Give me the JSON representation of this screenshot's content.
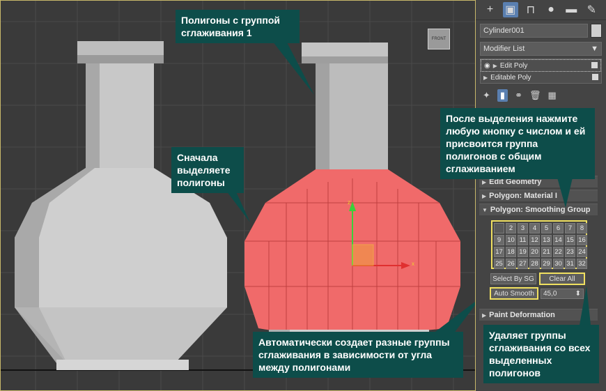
{
  "panel": {
    "object_name": "Cylinder001",
    "modifier_list": "Modifier List",
    "stack": [
      {
        "label": "Edit Poly"
      },
      {
        "label": "Editable Poly"
      }
    ],
    "rollouts": {
      "edit_geometry": "Edit Geometry",
      "material": "Polygon: Material I",
      "smoothing": "Polygon: Smoothing Group",
      "paint": "Paint Deformation"
    },
    "smoothing_groups": [
      "1",
      "2",
      "3",
      "4",
      "5",
      "6",
      "7",
      "8",
      "9",
      "10",
      "11",
      "12",
      "13",
      "14",
      "15",
      "16",
      "17",
      "18",
      "19",
      "20",
      "21",
      "22",
      "23",
      "24",
      "25",
      "26",
      "27",
      "28",
      "29",
      "30",
      "31",
      "32"
    ],
    "select_by_sg": "Select By SG",
    "clear_all": "Clear All",
    "auto_smooth": "Auto Smooth",
    "threshold": "45,0"
  },
  "viewport": {
    "view_cube_label": "FRONT"
  },
  "callouts": {
    "top": "Полигоны с группой сглаживания 1",
    "left": "Сначала выделяете полигоны",
    "right_top": "После выделения нажмите любую кнопку с числом и ей присвоится группа полигонов с общим сглаживанием",
    "bottom": "Автоматически создает разные группы сглаживания в зависимости от угла между полигонами",
    "bottom_right": "Удаляет группы сглаживания со всех выделенных полигонов"
  },
  "colors": {
    "callout_bg": "#0d4d4a",
    "highlight": "#f0e060",
    "selection": "#f06a6a"
  }
}
